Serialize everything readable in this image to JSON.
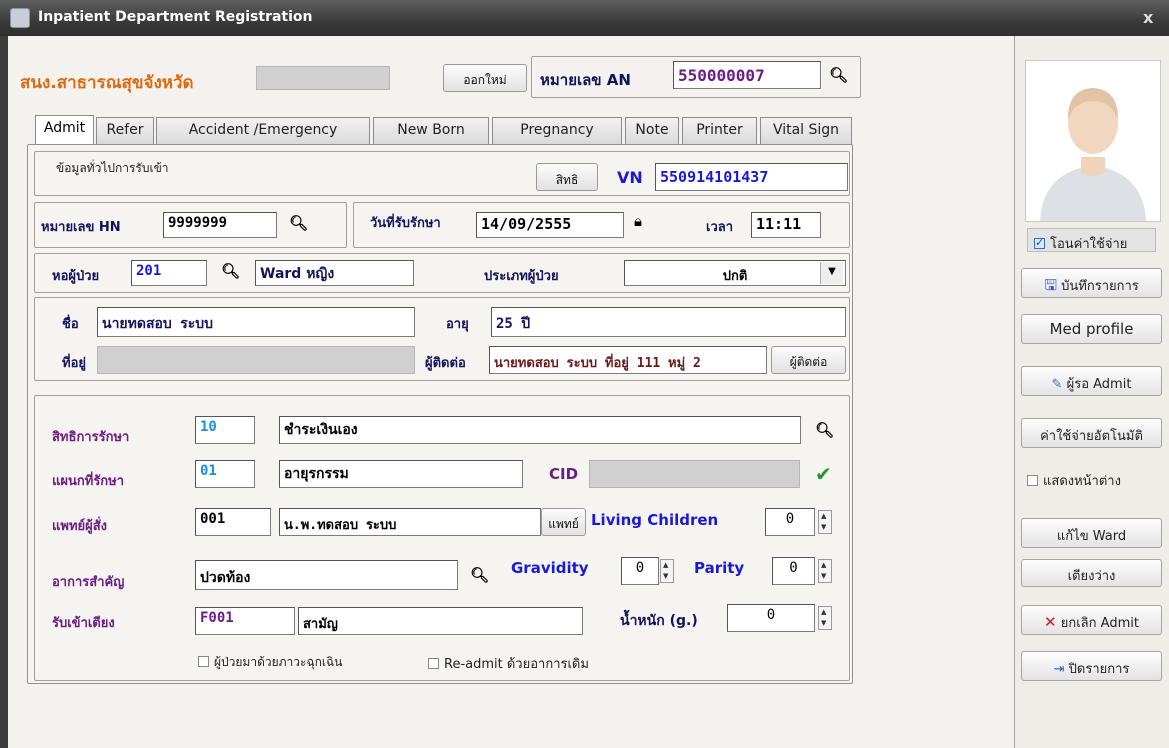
{
  "window": {
    "title": "Inpatient Department Registration",
    "close": "x"
  },
  "header": {
    "hospital": "สนง.สาธารณสุขจังหวัด",
    "new_button": "ออกใหม่",
    "an_label": "หมายเลข AN",
    "an_value": "550000007"
  },
  "tabs": [
    "Admit",
    "Refer",
    "Accident /Emergency",
    "New Born",
    "Pregnancy",
    "Note",
    "Printer",
    "Vital Sign"
  ],
  "general": {
    "section": "ข้อมูลทั่วไปการรับเข้า",
    "rights_button": "สิทธิ",
    "vn_label": "VN",
    "vn_value": "550914101437"
  },
  "hn": {
    "label": "หมายเลข HN",
    "value": "9999999"
  },
  "admit_date": {
    "label": "วันที่รับรักษา",
    "value": "14/09/2555",
    "time_label": "เวลา",
    "time_value": "11:11"
  },
  "ward": {
    "label": "หอผู้ป่วย",
    "code": "201",
    "name": "Ward หญิง",
    "type_label": "ประเภทผู้ป่วย",
    "type_value": "ปกติ"
  },
  "patient": {
    "name_label": "ชื่อ",
    "name": "นายทดสอบ ระบบ",
    "age_label": "อายุ",
    "age": "25 ปี",
    "address_label": "ที่อยู่",
    "contact_label": "ผู้ติดต่อ",
    "contact": "นายทดสอบ ระบบ ที่อยู่ 111 หมู่ 2",
    "contact_button": "ผู้ติดต่อ"
  },
  "treatment": {
    "right_label": "สิทธิการรักษา",
    "right_code": "10",
    "right_name": "ชำระเงินเอง",
    "dept_label": "แผนกที่รักษา",
    "dept_code": "01",
    "dept_name": "อายุรกรรม",
    "cid_label": "CID",
    "doctor_label": "แพทย์ผู้สั่ง",
    "doctor_code": "001",
    "doctor_name": "น.พ.ทดสอบ ระบบ",
    "doctor_button": "แพทย์",
    "living_label": "Living Children",
    "living_value": "0",
    "symptom_label": "อาการสำคัญ",
    "symptom_value": "ปวดท้อง",
    "gravidity_label": "Gravidity",
    "gravidity_value": "0",
    "parity_label": "Parity",
    "parity_value": "0",
    "bed_label": "รับเข้าเตียง",
    "bed_code": "F001",
    "bed_name": "สามัญ",
    "weight_label": "น้ำหนัก (g.)",
    "weight_value": "0",
    "emergency_check": "ผู้ป่วยมาด้วยภาวะฉุกเฉิน",
    "readmit_check": "Re-admit ด้วยอาการเดิม"
  },
  "sidebar": {
    "transfer_check": "โอนค่าใช้จ่าย",
    "buttons": {
      "save": "บันทึกรายการ",
      "med": "Med profile",
      "waiting": "ผู้รอ Admit",
      "auto_cost": "ค่าใช้จ่ายอัตโนมัติ",
      "edit_ward": "แก้ไข Ward",
      "free_bed": "เตียงว่าง",
      "cancel": "ยกเลิก Admit",
      "close": "ปิดรายการ"
    },
    "show_window_check": "แสดงหน้าต่าง"
  },
  "colors": {
    "hospital": "#e06a10",
    "purple": "#6b1f84",
    "blue_text": "#1a1ad6",
    "check_green": "#1e9b1e",
    "cancel_red": "#d01818"
  }
}
